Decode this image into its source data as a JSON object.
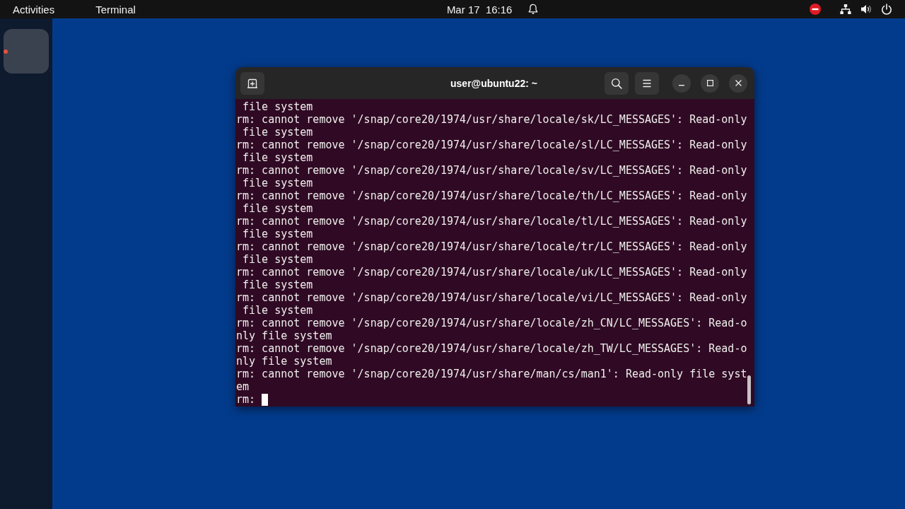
{
  "top_bar": {
    "activities": "Activities",
    "app_menu": "Terminal",
    "clock": "Mar 17  16:16"
  },
  "dock": {
    "items": [
      {
        "running": true
      }
    ]
  },
  "terminal": {
    "title": "user@ubuntu22: ~",
    "lines": [
      " file system",
      "rm: cannot remove '/snap/core20/1974/usr/share/locale/sk/LC_MESSAGES': Read-only",
      " file system",
      "rm: cannot remove '/snap/core20/1974/usr/share/locale/sl/LC_MESSAGES': Read-only",
      " file system",
      "rm: cannot remove '/snap/core20/1974/usr/share/locale/sv/LC_MESSAGES': Read-only",
      " file system",
      "rm: cannot remove '/snap/core20/1974/usr/share/locale/th/LC_MESSAGES': Read-only",
      " file system",
      "rm: cannot remove '/snap/core20/1974/usr/share/locale/tl/LC_MESSAGES': Read-only",
      " file system",
      "rm: cannot remove '/snap/core20/1974/usr/share/locale/tr/LC_MESSAGES': Read-only",
      " file system",
      "rm: cannot remove '/snap/core20/1974/usr/share/locale/uk/LC_MESSAGES': Read-only",
      " file system",
      "rm: cannot remove '/snap/core20/1974/usr/share/locale/vi/LC_MESSAGES': Read-only",
      " file system",
      "rm: cannot remove '/snap/core20/1974/usr/share/locale/zh_CN/LC_MESSAGES': Read-o",
      "nly file system",
      "rm: cannot remove '/snap/core20/1974/usr/share/locale/zh_TW/LC_MESSAGES': Read-o",
      "nly file system",
      "rm: cannot remove '/snap/core20/1974/usr/share/man/cs/man1': Read-only file syst",
      "em"
    ],
    "prompt": "rm:"
  }
}
